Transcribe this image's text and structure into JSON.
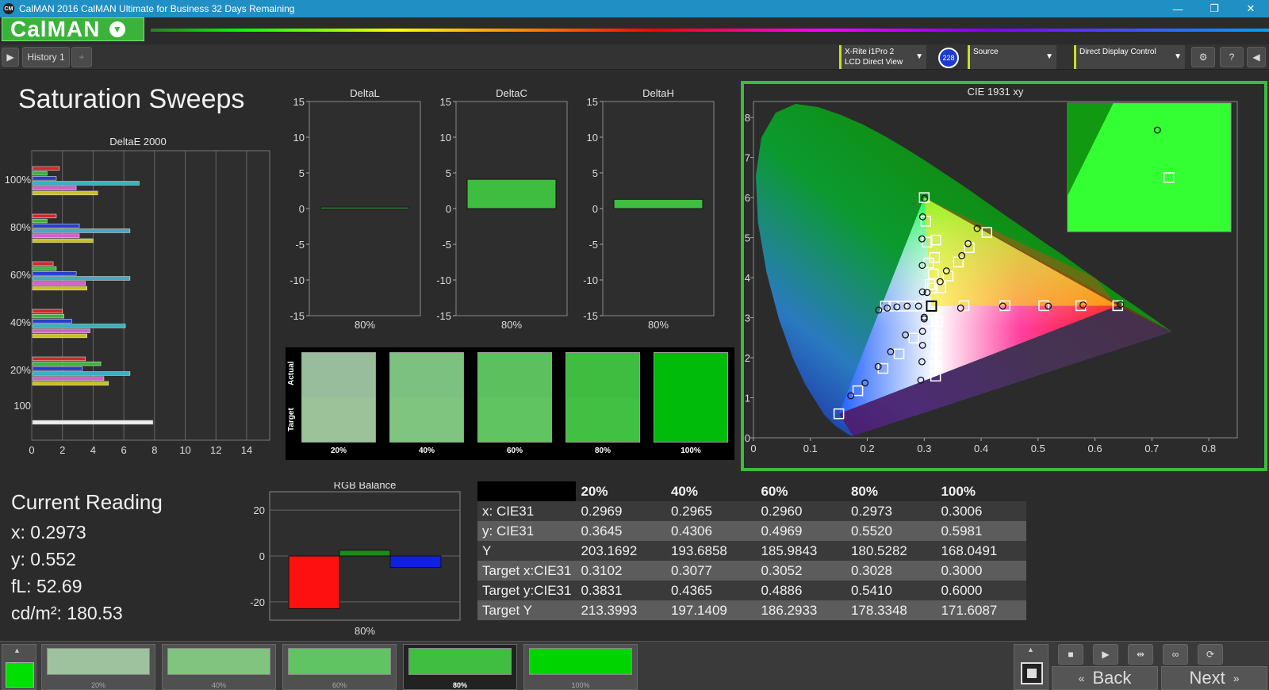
{
  "window": {
    "title": "CalMAN 2016 CalMAN Ultimate for Business 32 Days Remaining",
    "logo": "CM"
  },
  "brand": {
    "name": "CalMAN"
  },
  "toolbar": {
    "history_tab": "History 1",
    "add_tab": "+",
    "meter": {
      "line1": "X-Rite i1Pro 2",
      "line2": "LCD Direct View",
      "badge": "228"
    },
    "source": {
      "label": "Source"
    },
    "display": {
      "label": "Direct Display Control"
    }
  },
  "page": {
    "title": "Saturation Sweeps"
  },
  "deltae_chart": {
    "title": "DeltaE 2000",
    "xticks": [
      "0",
      "2",
      "4",
      "6",
      "8",
      "10",
      "12",
      "14"
    ],
    "ylabels": [
      "100%",
      "80%",
      "60%",
      "40%",
      "20%",
      "100"
    ],
    "colors": [
      "#cc2a2a",
      "#3cb33c",
      "#2a3ccc",
      "#3ab0c0",
      "#d060d0",
      "#c8c020"
    ],
    "groups": [
      {
        "label": "100%",
        "values": [
          1.8,
          1.0,
          1.6,
          7.0,
          2.9,
          4.3
        ]
      },
      {
        "label": "80%",
        "values": [
          1.6,
          1.0,
          3.1,
          6.4,
          3.1,
          4.0
        ]
      },
      {
        "label": "60%",
        "values": [
          1.4,
          1.6,
          2.9,
          6.4,
          3.5,
          3.6
        ]
      },
      {
        "label": "40%",
        "values": [
          2.0,
          2.1,
          2.6,
          6.1,
          3.8,
          3.6
        ]
      },
      {
        "label": "20%",
        "values": [
          3.5,
          4.5,
          3.3,
          6.4,
          4.7,
          5.0
        ]
      }
    ],
    "overall": {
      "label": "100",
      "value": 7.9
    }
  },
  "delta_charts": [
    {
      "title": "DeltaL",
      "value": 0.2,
      "xlabel": "80%"
    },
    {
      "title": "DeltaC",
      "value": 4.1,
      "xlabel": "80%"
    },
    {
      "title": "DeltaH",
      "value": 1.3,
      "xlabel": "80%"
    }
  ],
  "delta_yticks": [
    "15",
    "10",
    "5",
    "0",
    "-5",
    "-10",
    "-15"
  ],
  "swatches": {
    "actual_label": "Actual",
    "target_label": "Target",
    "items": [
      {
        "label": "20%",
        "actual": "#98bd9c",
        "target": "#9cc29a"
      },
      {
        "label": "40%",
        "actual": "#7cc180",
        "target": "#7fc47f"
      },
      {
        "label": "60%",
        "actual": "#5cc05f",
        "target": "#60c460"
      },
      {
        "label": "80%",
        "actual": "#3fbd41",
        "target": "#41c043"
      },
      {
        "label": "100%",
        "actual": "#00bb0a",
        "target": "#00bb0a"
      }
    ]
  },
  "cie": {
    "title": "CIE 1931 xy",
    "xticks": [
      "0",
      "0.1",
      "0.2",
      "0.3",
      "0.4",
      "0.5",
      "0.6",
      "0.7",
      "0.8"
    ],
    "yticks": [
      "0",
      "0.1",
      "0.2",
      "0.3",
      "0.4",
      "0.5",
      "0.6",
      "0.7",
      "0.8"
    ],
    "gamut": [
      [
        0.64,
        0.33
      ],
      [
        0.3,
        0.6
      ],
      [
        0.15,
        0.06
      ]
    ],
    "white": [
      0.3127,
      0.329
    ],
    "targets": [
      [
        0.2934,
        0.329
      ],
      [
        0.2769,
        0.329
      ],
      [
        0.261,
        0.329
      ],
      [
        0.2465,
        0.329
      ],
      [
        0.232,
        0.329
      ],
      [
        0.3102,
        0.3831
      ],
      [
        0.3077,
        0.4365
      ],
      [
        0.3052,
        0.4886
      ],
      [
        0.3028,
        0.541
      ],
      [
        0.3,
        0.6
      ],
      [
        0.3048,
        0.29
      ],
      [
        0.2817,
        0.2491
      ],
      [
        0.2558,
        0.2094
      ],
      [
        0.2276,
        0.1733
      ],
      [
        0.1834,
        0.1176
      ],
      [
        0.15,
        0.06
      ],
      [
        0.3143,
        0.374
      ],
      [
        0.3163,
        0.4091
      ],
      [
        0.3182,
        0.4504
      ],
      [
        0.3202,
        0.494
      ],
      [
        0.323,
        0.2906
      ],
      [
        0.322,
        0.254
      ],
      [
        0.321,
        0.217
      ],
      [
        0.32,
        0.18
      ],
      [
        0.32,
        0.154
      ],
      [
        0.37,
        0.33
      ],
      [
        0.442,
        0.33
      ],
      [
        0.51,
        0.33
      ],
      [
        0.575,
        0.33
      ],
      [
        0.64,
        0.33
      ],
      [
        0.329,
        0.375
      ],
      [
        0.342,
        0.404
      ],
      [
        0.36,
        0.439
      ],
      [
        0.379,
        0.475
      ],
      [
        0.41,
        0.513
      ]
    ],
    "measured": [
      [
        0.2969,
        0.3645
      ],
      [
        0.2965,
        0.4306
      ],
      [
        0.296,
        0.4969
      ],
      [
        0.2973,
        0.552
      ],
      [
        0.3006,
        0.5981
      ],
      [
        0.29,
        0.329
      ],
      [
        0.27,
        0.329
      ],
      [
        0.252,
        0.327
      ],
      [
        0.235,
        0.324
      ],
      [
        0.22,
        0.319
      ],
      [
        0.3,
        0.297
      ],
      [
        0.267,
        0.257
      ],
      [
        0.241,
        0.215
      ],
      [
        0.219,
        0.178
      ],
      [
        0.196,
        0.137
      ],
      [
        0.171,
        0.105
      ],
      [
        0.305,
        0.363
      ],
      [
        0.3,
        0.301
      ],
      [
        0.297,
        0.266
      ],
      [
        0.297,
        0.231
      ],
      [
        0.296,
        0.19
      ],
      [
        0.294,
        0.144
      ],
      [
        0.364,
        0.324
      ],
      [
        0.438,
        0.329
      ],
      [
        0.518,
        0.329
      ],
      [
        0.579,
        0.332
      ],
      [
        0.645,
        0.333
      ],
      [
        0.328,
        0.39
      ],
      [
        0.339,
        0.417
      ],
      [
        0.366,
        0.455
      ],
      [
        0.377,
        0.485
      ],
      [
        0.393,
        0.523
      ]
    ],
    "inset_measured": [
      0.55,
      0.21
    ],
    "inset_target": [
      0.62,
      0.58
    ]
  },
  "current_reading": {
    "title": "Current Reading",
    "x": "x: 0.2973",
    "y": "y: 0.552",
    "fl": "fL: 52.69",
    "cdm2": "cd/m²: 180.53"
  },
  "rgb_balance": {
    "title": "RGB Balance",
    "yticks": [
      "20",
      "0",
      "-20"
    ],
    "values": [
      {
        "name": "R",
        "value": -23,
        "color": "#ff1010"
      },
      {
        "name": "G",
        "value": 2.5,
        "color": "#1a8c1a"
      },
      {
        "name": "B",
        "value": -5,
        "color": "#1020e0"
      }
    ],
    "xlabel": "80%"
  },
  "table": {
    "headers": [
      "",
      "20%",
      "40%",
      "60%",
      "80%",
      "100%"
    ],
    "rows": [
      [
        "x: CIE31",
        "0.2969",
        "0.2965",
        "0.2960",
        "0.2973",
        "0.3006"
      ],
      [
        "y: CIE31",
        "0.3645",
        "0.4306",
        "0.4969",
        "0.5520",
        "0.5981"
      ],
      [
        "Y",
        "203.1692",
        "193.6858",
        "185.9843",
        "180.5282",
        "168.0491"
      ],
      [
        "Target x:CIE31",
        "0.3102",
        "0.3077",
        "0.3052",
        "0.3028",
        "0.3000"
      ],
      [
        "Target y:CIE31",
        "0.3831",
        "0.4365",
        "0.4886",
        "0.5410",
        "0.6000"
      ],
      [
        "Target Y",
        "213.3993",
        "197.1409",
        "186.2933",
        "178.3348",
        "171.6087"
      ]
    ]
  },
  "bottom": {
    "current_color": "#00e000",
    "selected": "80%",
    "swatches": [
      {
        "label": "20%",
        "color": "#9ec29d"
      },
      {
        "label": "40%",
        "color": "#80c480"
      },
      {
        "label": "60%",
        "color": "#61c462"
      },
      {
        "label": "80%",
        "color": "#3fbe41"
      },
      {
        "label": "100%",
        "color": "#00d400"
      }
    ],
    "back_label": "Back",
    "next_label": "Next"
  }
}
